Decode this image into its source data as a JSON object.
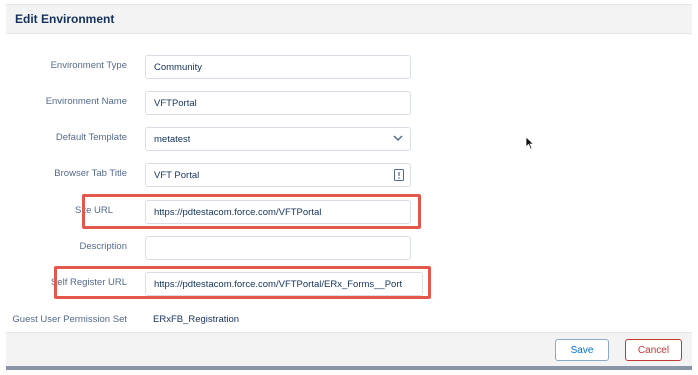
{
  "header": {
    "title": "Edit Environment"
  },
  "form": {
    "environment_type": {
      "label": "Environment Type",
      "value": "Community"
    },
    "environment_name": {
      "label": "Environment Name",
      "value": "VFTPortal"
    },
    "default_template": {
      "label": "Default Template",
      "value": "metatest",
      "icon": "chevron-down-icon"
    },
    "browser_tab_title": {
      "label": "Browser Tab Title",
      "value": "VFT Portal",
      "icon": "text-field-icon"
    },
    "site_url": {
      "label": "Site URL",
      "value": "https://pdtestacom.force.com/VFTPortal"
    },
    "description": {
      "label": "Description",
      "value": ""
    },
    "self_register_url": {
      "label": "Self Register URL",
      "value": "https://pdtestacom.force.com/VFTPortal/ERx_Forms__Port"
    },
    "guest_user_permission_set": {
      "label": "Guest User Permission Set",
      "value": "ERxFB_Registration"
    }
  },
  "footer": {
    "save_label": "Save",
    "cancel_label": "Cancel"
  },
  "colors": {
    "highlight": "#e3574c",
    "brand_blue": "#0070d2",
    "cancel_red": "#c23934"
  }
}
